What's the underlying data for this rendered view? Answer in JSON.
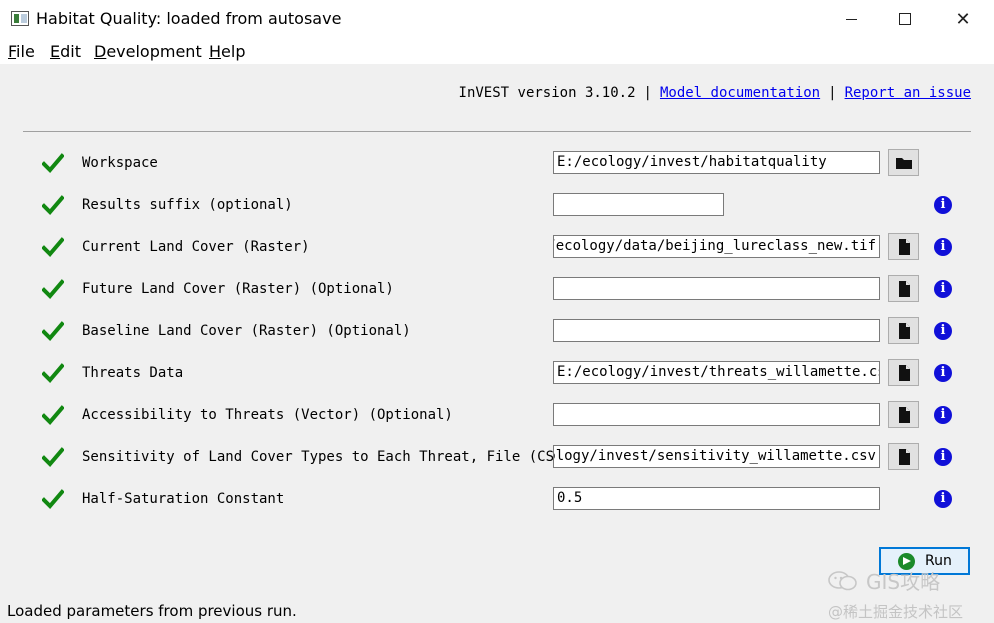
{
  "window": {
    "title": "Habitat Quality: loaded from autosave",
    "minimize_label": "minimize",
    "maximize_label": "maximize",
    "close_label": "✕"
  },
  "menu": {
    "file": {
      "mnemonic": "F",
      "rest": "ile"
    },
    "edit": {
      "mnemonic": "E",
      "rest": "dit"
    },
    "development": {
      "mnemonic": "D",
      "rest": "evelopment"
    },
    "help": {
      "mnemonic": "H",
      "rest": "elp"
    }
  },
  "header": {
    "version_text": "InVEST version 3.10.2",
    "separator": "|",
    "model_docs_link": "Model documentation",
    "report_issue_link": "Report an issue"
  },
  "inputs": [
    {
      "label": "Workspace",
      "value": "E:/ecology/invest/habitatquality",
      "valid": true
    },
    {
      "label": "Results suffix (optional)",
      "value": "",
      "valid": true
    },
    {
      "label": "Current Land Cover (Raster)",
      "value": "E:/ecology/data/beijing_lureclass_new.tif",
      "valid": true
    },
    {
      "label": "Future Land Cover (Raster) (Optional)",
      "value": "",
      "valid": true
    },
    {
      "label": "Baseline Land Cover (Raster) (Optional)",
      "value": "",
      "valid": true
    },
    {
      "label": "Threats Data",
      "value": "E:/ecology/invest/threats_willamette.csv",
      "valid": true
    },
    {
      "label": "Accessibility to Threats (Vector) (Optional)",
      "value": "",
      "valid": true
    },
    {
      "label": "Sensitivity of Land Cover Types to Each Threat, File (CSV)",
      "value": "E:/ecology/invest/sensitivity_willamette.csv",
      "valid": true
    },
    {
      "label": "Half-Saturation Constant",
      "value": "0.5",
      "valid": true
    }
  ],
  "icons": {
    "valid": "checkmark-icon",
    "folder": "folder-icon",
    "file": "file-icon",
    "info": "info-icon",
    "run": "play-icon"
  },
  "info_glyph": "i",
  "run_button": {
    "label": "Run"
  },
  "status_bar": {
    "text": "Loaded parameters from previous run."
  },
  "watermark": {
    "line1": "GIS攻略",
    "line2": "@稀土掘金技术社区"
  },
  "colors": {
    "check": "#118811",
    "info": "#1010d8",
    "link": "#0000ee",
    "run_accent": "#0078d7"
  }
}
